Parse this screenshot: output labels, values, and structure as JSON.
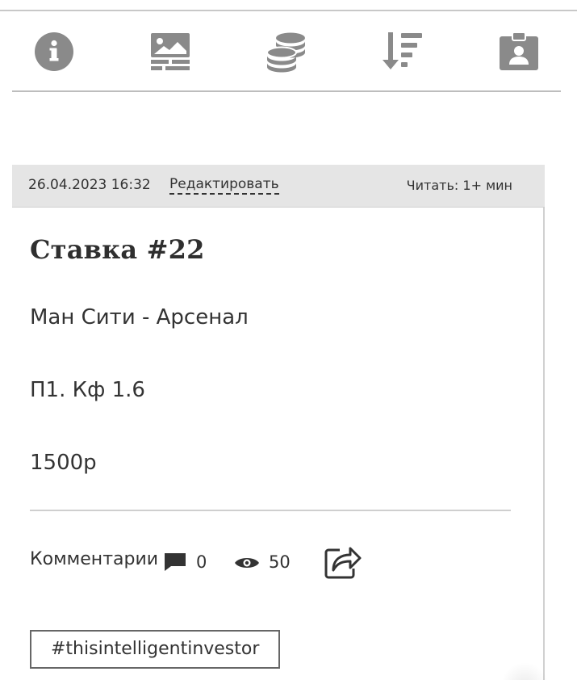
{
  "toolbar": {
    "items": [
      {
        "icon": "info-icon",
        "label": "info"
      },
      {
        "icon": "image-gallery-icon",
        "label": "media"
      },
      {
        "icon": "coins-icon",
        "label": "coins"
      },
      {
        "icon": "sort-descending-icon",
        "label": "sort"
      },
      {
        "icon": "id-badge-icon",
        "label": "profile"
      }
    ],
    "icon_color": "#8a8a8a"
  },
  "post": {
    "date": "26.04.2023 16:32",
    "edit_label": "Редактировать",
    "read_time": "Читать: 1+ мин",
    "title": "Ставка #22",
    "lines": [
      "Ман Сити - Арсенал",
      "П1. Кф 1.6",
      "1500р"
    ],
    "comments_label": "Комментарии",
    "comments_count": "0",
    "views_count": "50",
    "tag": "#thisintelligentinvestor"
  },
  "colors": {
    "meta_bar_bg": "#e5e5e5",
    "text": "#333333",
    "divider": "#cfcfcf"
  }
}
